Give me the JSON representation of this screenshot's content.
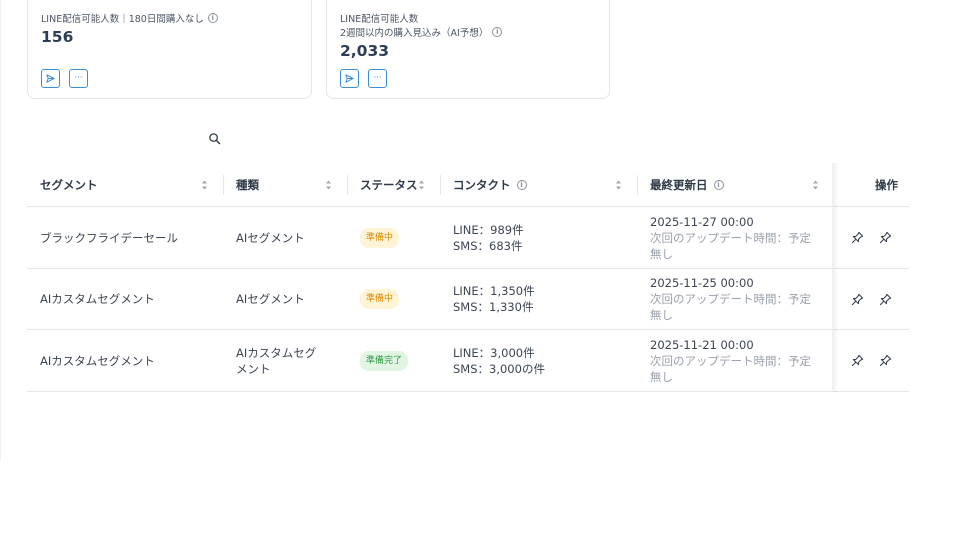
{
  "cards": [
    {
      "label": "LINE配信可能人数｜180日間購入なし",
      "value": "156"
    },
    {
      "label_line1": "LINE配信可能人数",
      "label_line2": "2週間以内の購入見込み（AI予想）",
      "value": "2,033"
    }
  ],
  "card_buttons": {
    "more": "···"
  },
  "info_glyph": "i",
  "table": {
    "headers": {
      "segment": "セグメント",
      "type": "種類",
      "status": "ステータス",
      "contact": "コンタクト",
      "updated": "最終更新日",
      "actions": "操作"
    },
    "rows": [
      {
        "segment": "ブラックフライデーセール",
        "type": "AIセグメント",
        "status": "準備中",
        "contact_line": "LINE：989件",
        "contact_sms": "SMS：683件",
        "updated": "2025-11-27 00:00",
        "next_update": "次回のアップデート時間：予定無し"
      },
      {
        "segment": "AIカスタムセグメント",
        "type": "AIセグメント",
        "status": "準備中",
        "contact_line": "LINE：1,350件",
        "contact_sms": "SMS：1,330件",
        "updated": "2025-11-25 00:00",
        "next_update": "次回のアップデート時間：予定無し"
      },
      {
        "segment": "AIカスタムセグメント",
        "type": "AIカスタムセグメント",
        "status": "準備完了",
        "contact_line": "LINE：3,000件",
        "contact_sms": "SMS：3,000の件",
        "updated": "2025-11-21 00:00",
        "next_update": "次回のアップデート時間：予定無し"
      }
    ]
  },
  "colors": {
    "accent": "#3b8fd6",
    "status_preparing_bg": "#fff4d6",
    "status_preparing_text": "#d98a00",
    "status_ready_bg": "#e2f5e4",
    "status_ready_text": "#2e9a44"
  }
}
